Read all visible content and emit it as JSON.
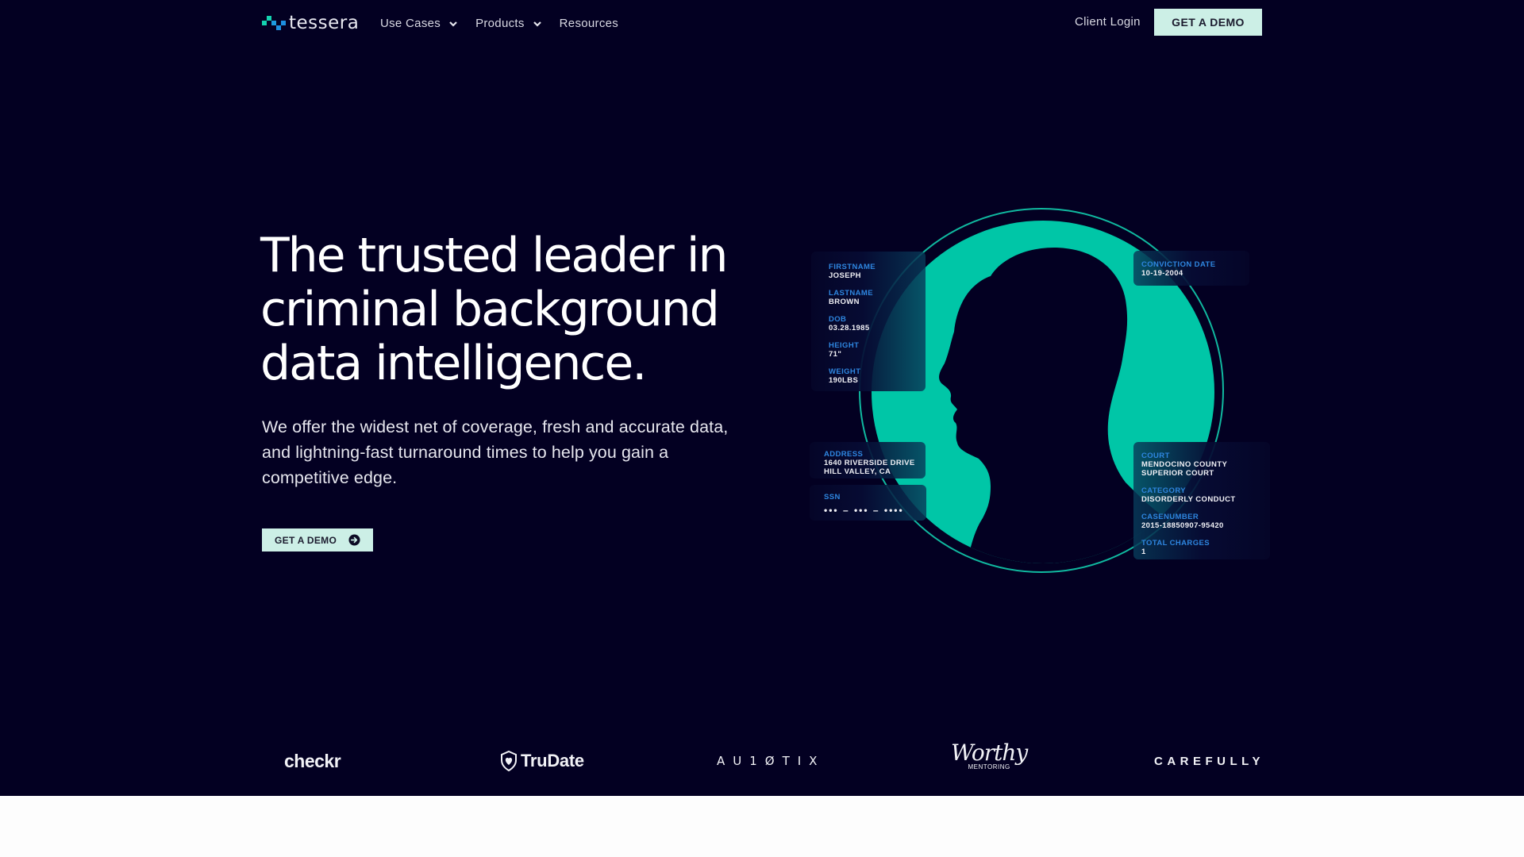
{
  "brand": {
    "name": "tessera",
    "accent": "#ccefe6",
    "background": "#030022",
    "teal": "#00c6a7",
    "label_blue": "#2e86e0"
  },
  "nav": {
    "items": [
      {
        "label": "Use Cases",
        "has_dropdown": true,
        "icon": "chevron-down-icon"
      },
      {
        "label": "Products",
        "has_dropdown": true,
        "icon": "chevron-down-icon"
      },
      {
        "label": "Resources",
        "has_dropdown": false
      }
    ],
    "client_login": "Client Login",
    "cta": "GET A DEMO"
  },
  "hero": {
    "headline": "The trusted leader in criminal background data intelligence.",
    "subtext": "We offer the widest net of coverage, fresh and accurate data, and lightning-fast turnaround times to help you gain a competitive edge.",
    "cta": "GET A DEMO",
    "cta_icon": "arrow-right-circle-icon"
  },
  "profile": {
    "identity_card": [
      {
        "label": "FIRSTNAME",
        "value": "JOSEPH"
      },
      {
        "label": "LASTNAME",
        "value": "BROWN"
      },
      {
        "label": "DOB",
        "value": "03.28.1985"
      },
      {
        "label": "HEIGHT",
        "value": "71\""
      },
      {
        "label": "WEIGHT",
        "value": "190LBS"
      }
    ],
    "address_card": {
      "label": "ADDRESS",
      "value": "1640 RIVERSIDE DRIVE\nHILL VALLEY, CA"
    },
    "ssn_card": {
      "label": "SSN",
      "value": "••• – ••• – ••••"
    },
    "conviction_card": {
      "label": "CONVICTION DATE",
      "value": "10-19-2004"
    },
    "case_card": [
      {
        "label": "COURT",
        "value": "MENDOCINO COUNTY\nSUPERIOR COURT"
      },
      {
        "label": "CATEGORY",
        "value": "DISORDERLY CONDUCT"
      },
      {
        "label": "CASENUMBER",
        "value": "2015-18850907-95420"
      },
      {
        "label": "TOTAL CHARGES",
        "value": "1"
      }
    ]
  },
  "partners": {
    "checkr": "checkr",
    "trudate": "TruDate",
    "autotix": "AU1ØTIX",
    "worthy": "Worthy",
    "worthy_sub": "MENTORING",
    "carefully": "CAREFULLY"
  }
}
